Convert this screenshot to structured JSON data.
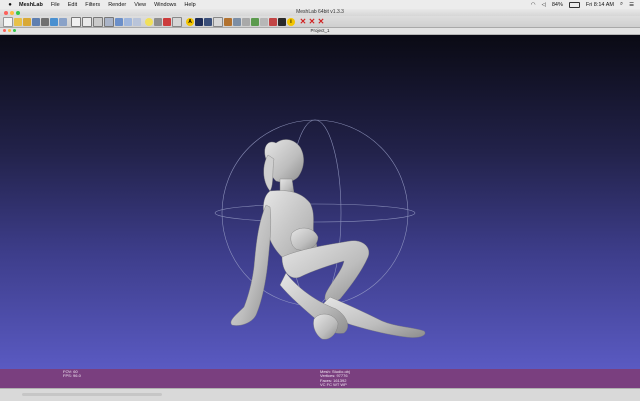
{
  "menubar": {
    "app": "MeshLab",
    "items": [
      "File",
      "Edit",
      "Filters",
      "Render",
      "View",
      "Windows",
      "Help"
    ],
    "battery": "84%",
    "clock": "Fri 8:14 AM"
  },
  "window": {
    "title": "MeshLab 64bit v1.3.3"
  },
  "document": {
    "tab": "Project_1"
  },
  "status": {
    "fov": "FOV: 60",
    "fps": "FPS:   96.0",
    "mesh": "Mesh: Studio.obj",
    "vertices": "Vertices: 97776",
    "faces": "Faces: 161392",
    "vc": "VC FC WT WP"
  },
  "toolbar": {
    "icons": [
      "new-project-icon",
      "open-project-icon",
      "open-mesh-icon",
      "reload-icon",
      "save-icon",
      "snapshot-icon",
      "layers-icon",
      "points-icon",
      "wireframe-icon",
      "hidden-lines-icon",
      "flat-lines-icon",
      "flat-icon",
      "smooth-icon",
      "texture-icon",
      "lighting-icon",
      "backface-icon",
      "color-icon",
      "fullscreen-icon",
      "render-shader-icon",
      "pick-icon",
      "measure-icon",
      "align-icon",
      "paint-icon",
      "select-faces-icon",
      "select-vertices-icon",
      "select-connected-icon",
      "delete-faces-icon",
      "delete-vertices-icon",
      "info-icon",
      "close-icon-1",
      "close-icon-2",
      "close-icon-3"
    ]
  },
  "colors": {
    "statusbar": "#7a3f7f",
    "viewport_bottom": "#5a5ac2",
    "viewport_top": "#0a0a14"
  }
}
